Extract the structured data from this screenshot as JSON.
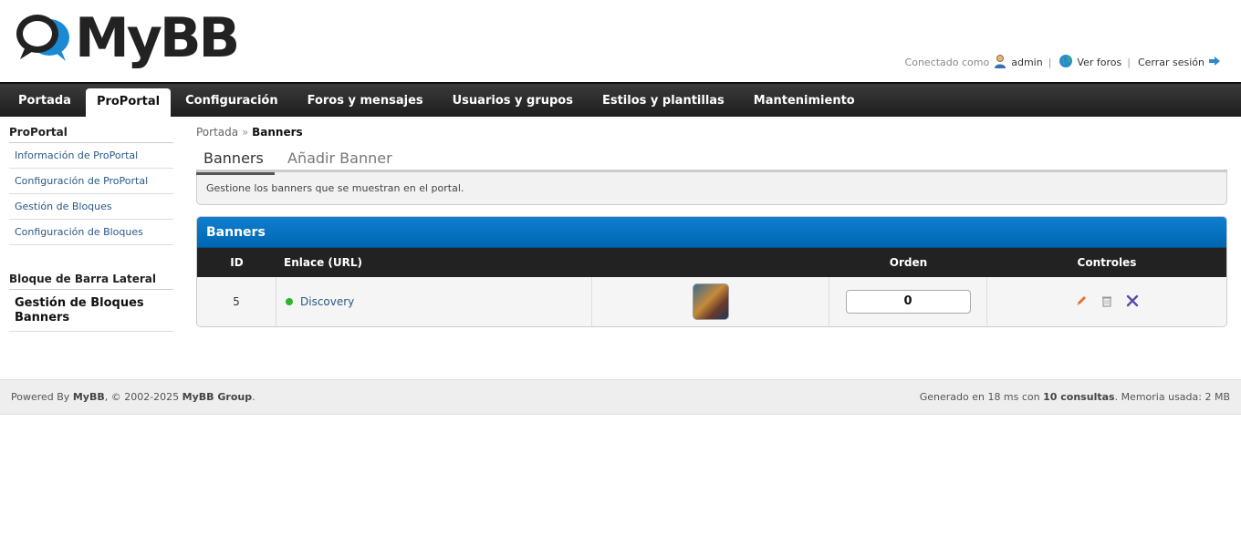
{
  "header": {
    "logo_text": "MyBB",
    "connected_as": "Conectado como",
    "username": "admin",
    "view_forums": "Ver foros",
    "logout": "Cerrar sesión",
    "separator": "|"
  },
  "menu": {
    "items": [
      {
        "label": "Portada"
      },
      {
        "label": "ProPortal"
      },
      {
        "label": "Configuración"
      },
      {
        "label": "Foros y mensajes"
      },
      {
        "label": "Usuarios y grupos"
      },
      {
        "label": "Estilos y plantillas"
      },
      {
        "label": "Mantenimiento"
      }
    ],
    "active": "ProPortal"
  },
  "sidebar": {
    "section1": {
      "title": "ProPortal",
      "items": [
        {
          "label": "Información de ProPortal"
        },
        {
          "label": "Configuración de ProPortal"
        },
        {
          "label": "Gestión de Bloques"
        },
        {
          "label": "Configuración de Bloques"
        }
      ]
    },
    "section2": {
      "title": "Bloque de Barra Lateral",
      "items": [
        {
          "label": "Gestión de Bloques Banners"
        }
      ]
    }
  },
  "breadcrumb": {
    "home": "Portada",
    "separator": "»",
    "current": "Banners"
  },
  "tabs": [
    {
      "label": "Banners"
    },
    {
      "label": "Añadir Banner"
    }
  ],
  "notice": "Gestione los banners que se muestran en el portal.",
  "table": {
    "title": "Banners",
    "columns": {
      "id": "ID",
      "link": "Enlace (URL)",
      "image": "",
      "order": "Orden",
      "controls": "Controles"
    },
    "rows": [
      {
        "id": "5",
        "status": "active",
        "link_text": "Discovery",
        "order": "0"
      }
    ]
  },
  "footer": {
    "powered_by": "Powered By",
    "mybb": "MyBB",
    "copyright": ", © 2002-2025",
    "group": "MyBB Group",
    "period": ".",
    "generated_prefix": "Generado en 18 ms con",
    "queries": "10 consultas",
    "memory": ". Memoria usada: 2 MB"
  },
  "colors": {
    "menu_bg": "#262626",
    "table_header_blue": "#0a74c4",
    "link": "#2a5885",
    "status_active": "#2bb52b"
  }
}
